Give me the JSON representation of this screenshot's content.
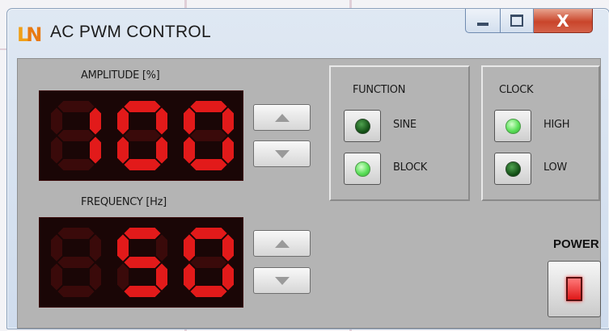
{
  "window": {
    "title": "AC PWM CONTROL",
    "logo_text": "LN",
    "close_glyph": "X"
  },
  "amplitude": {
    "label": "AMPLITUDE [%]",
    "value": "100",
    "digits": [
      "1",
      "0",
      "0"
    ]
  },
  "frequency": {
    "label": "FREQUENCY [Hz]",
    "value": "50",
    "digits": [
      "",
      "5",
      "0"
    ]
  },
  "function": {
    "title": "FUNCTION",
    "options": [
      {
        "label": "SINE",
        "led": "dark"
      },
      {
        "label": "BLOCK",
        "led": "bright"
      }
    ]
  },
  "clock": {
    "title": "CLOCK",
    "options": [
      {
        "label": "HIGH",
        "led": "bright"
      },
      {
        "label": "LOW",
        "led": "dark"
      }
    ]
  },
  "power": {
    "label": "POWER"
  },
  "colors": {
    "segment_on": "#e21a1a",
    "segment_off": "#3a0a0a",
    "led_dark": "#1f6b22",
    "led_bright": "#7ef07a",
    "power_lamp": "#e01818"
  }
}
